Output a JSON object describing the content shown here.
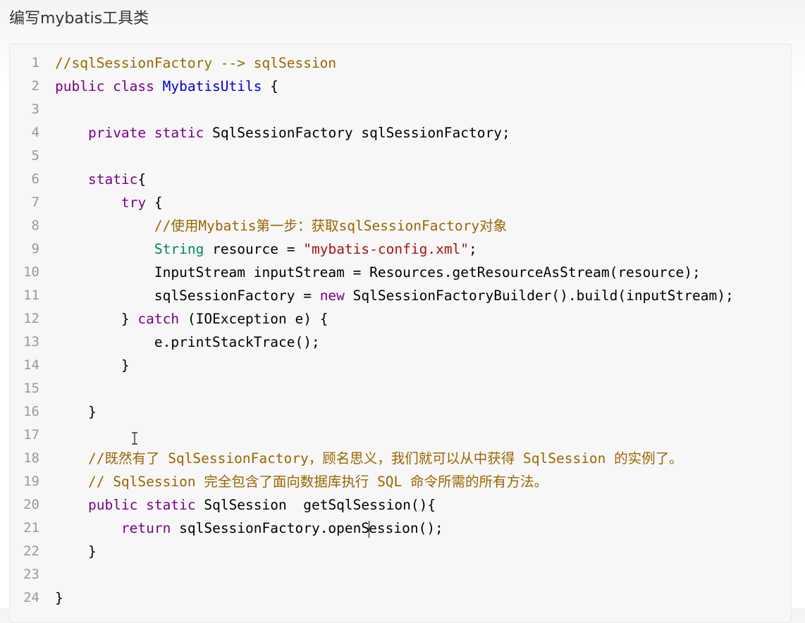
{
  "heading": "编写mybatis工具类",
  "line_numbers": [
    "1",
    "2",
    "3",
    "4",
    "5",
    "6",
    "7",
    "8",
    "9",
    "10",
    "11",
    "12",
    "13",
    "14",
    "15",
    "16",
    "17",
    "18",
    "19",
    "20",
    "21",
    "22",
    "23",
    "24"
  ],
  "code": {
    "l1": "//sqlSessionFactory --> sqlSession",
    "l2_kw": "public class ",
    "l2_cls": "MybatisUtils",
    "l2_rest": " {",
    "l4_ind": "    ",
    "l4_kw": "private static ",
    "l4_rest": "SqlSessionFactory sqlSessionFactory;",
    "l6_ind": "    ",
    "l6_kw": "static",
    "l6_rest": "{",
    "l7_ind": "        ",
    "l7_kw": "try",
    "l7_rest": " {",
    "l8_ind": "            ",
    "l8_cmt": "//使用Mybatis第一步：获取sqlSessionFactory对象",
    "l9_ind": "            ",
    "l9_typ": "String",
    "l9_mid": " resource = ",
    "l9_str": "\"mybatis-config.xml\"",
    "l9_end": ";",
    "l10": "            InputStream inputStream = Resources.getResourceAsStream(resource);",
    "l11_pre": "            sqlSessionFactory = ",
    "l11_kw": "new",
    "l11_rest": " SqlSessionFactoryBuilder().build(inputStream);",
    "l12_pre": "        } ",
    "l12_kw": "catch",
    "l12_rest": " (IOException e) {",
    "l13": "            e.printStackTrace();",
    "l14": "        }",
    "l16": "    }",
    "l18_ind": "    ",
    "l18_cmt": "//既然有了 SqlSessionFactory，顾名思义，我们就可以从中获得 SqlSession 的实例了。",
    "l19_ind": "    ",
    "l19_cmt": "// SqlSession 完全包含了面向数据库执行 SQL 命令所需的所有方法。",
    "l20_ind": "    ",
    "l20_kw": "public static ",
    "l20_rest": "SqlSession  getSqlSession(){",
    "l21_ind": "        ",
    "l21_kw": "return",
    "l21_a": " sqlSessionFactory.openS",
    "l21_b": "ession();",
    "l22": "    }",
    "l24": "}"
  }
}
